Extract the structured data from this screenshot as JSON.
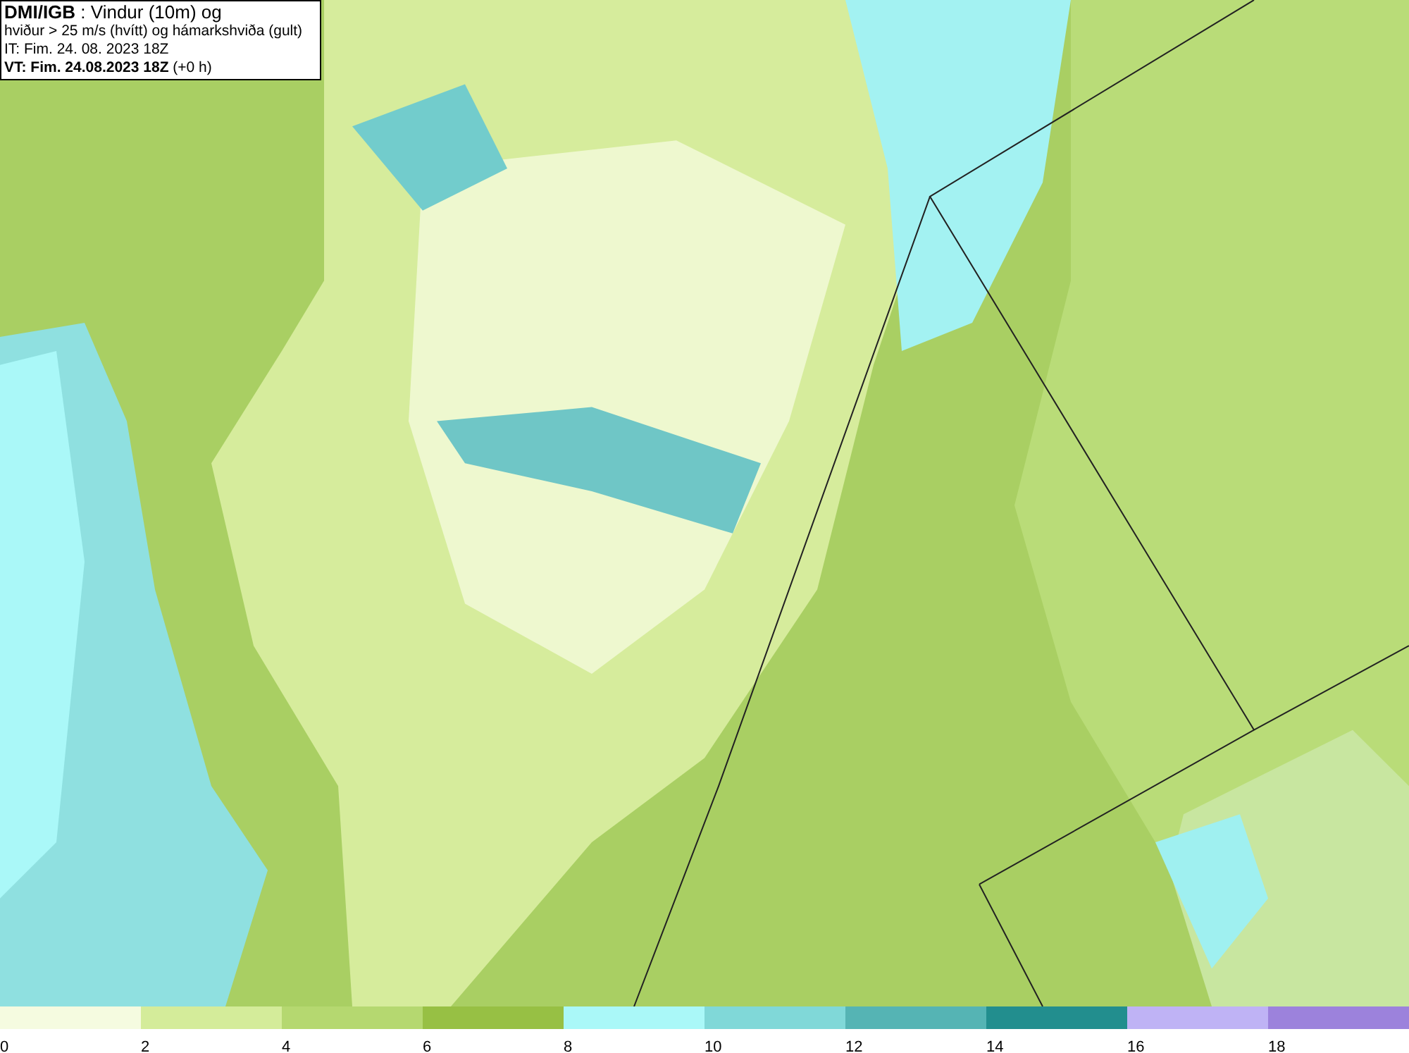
{
  "title_box": {
    "lines": [
      "**DMI/IGB** : Vindur (10m) og",
      "hviður > 25 m/s (hvítt) og hámarkshviða (gult)",
      "IT: Fim. 24. 08. 2023 18Z",
      "**VT: Fim. 24.08.2023 18Z** (+0 h)"
    ]
  },
  "legend": {
    "segments": [
      {
        "label": "0",
        "color": "#f5fbe0"
      },
      {
        "label": "2",
        "color": "#d4ec9a"
      },
      {
        "label": "4",
        "color": "#b5d870"
      },
      {
        "label": "6",
        "color": "#97c044"
      },
      {
        "label": "8",
        "color": "#aaf8f8"
      },
      {
        "label": "10",
        "color": "#80d8d8"
      },
      {
        "label": "12",
        "color": "#55b4b4"
      },
      {
        "label": "14",
        "color": "#228e8e"
      },
      {
        "label": "16",
        "color": "#bfb3f5"
      },
      {
        "label": "18",
        "color": "#9c82dc"
      }
    ]
  }
}
